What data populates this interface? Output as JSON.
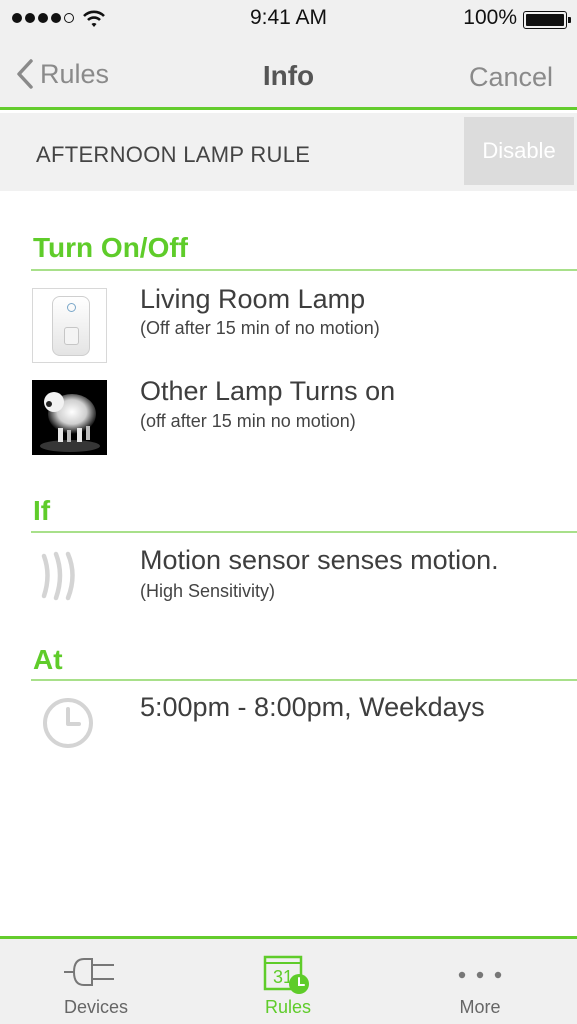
{
  "status_bar": {
    "time": "9:41 AM",
    "battery": "100%"
  },
  "nav": {
    "back_label": "Rules",
    "title": "Info",
    "cancel_label": "Cancel"
  },
  "rule": {
    "name": "AFTERNOON LAMP RULE",
    "disable_label": "Disable"
  },
  "sections": {
    "turn": {
      "title": "Turn On/Off",
      "items": [
        {
          "title": "Living Room Lamp",
          "subtitle": "(Off after 15 min of no motion)",
          "icon": "wemo-switch"
        },
        {
          "title": "Other Lamp Turns on",
          "subtitle": "(off after 15 min no motion)",
          "icon": "sheep-lamp"
        }
      ]
    },
    "if": {
      "title": "If",
      "items": [
        {
          "title": "Motion sensor senses motion.",
          "subtitle": "(High Sensitivity)",
          "icon": "motion-waves"
        }
      ]
    },
    "at": {
      "title": "At",
      "items": [
        {
          "title": "5:00pm - 8:00pm, Weekdays",
          "icon": "clock"
        }
      ]
    }
  },
  "tabs": [
    {
      "label": "Devices",
      "icon": "plug",
      "active": false
    },
    {
      "label": "Rules",
      "icon": "calendar",
      "calendar_day": "31",
      "active": true
    },
    {
      "label": "More",
      "icon": "ellipsis",
      "active": false
    }
  ],
  "colors": {
    "accent": "#5fcc2a",
    "bar_bg": "#f0f0f0",
    "disabled_button": "#dcdcdc"
  }
}
